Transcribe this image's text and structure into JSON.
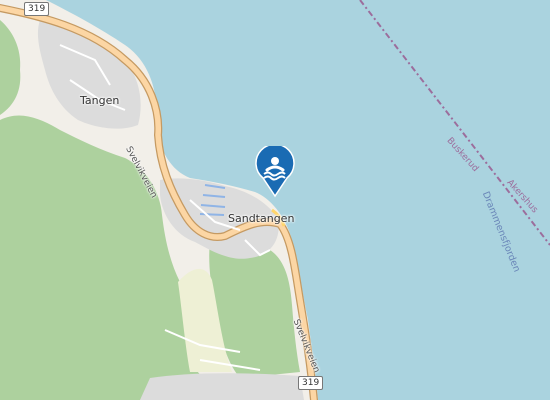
{
  "places": [
    {
      "name": "Tangen"
    },
    {
      "name": "Sandtangen"
    }
  ],
  "roads": {
    "name_north": "Svelvikveien",
    "name_south": "Svelvikveien",
    "shield_nw": "319",
    "shield_south": "319"
  },
  "water_body": "Drammensfjorden",
  "admin_regions": {
    "west": "Buskerud",
    "east": "Akershus"
  },
  "marker": {
    "icon": "swimming-icon",
    "color": "#1a6bb3"
  },
  "colors": {
    "water": "#aad3df",
    "forest": "#add19e",
    "land": "#f2efe9",
    "residential": "#dcdcdc",
    "road": "#fcd6a4",
    "road_casing": "#c59a62",
    "border": "#9c6d9c"
  }
}
